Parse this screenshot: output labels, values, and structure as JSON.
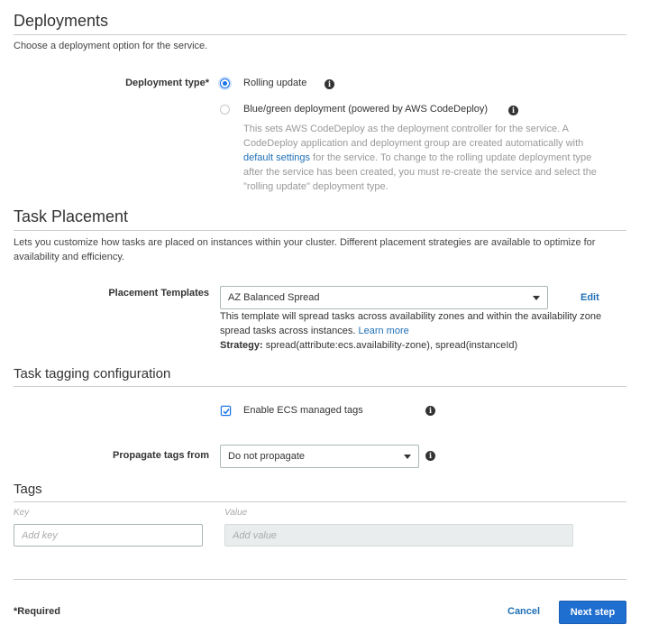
{
  "deployments": {
    "title": "Deployments",
    "description": "Choose a deployment option for the service.",
    "type_label": "Deployment type*",
    "options": [
      {
        "label": "Rolling update",
        "selected": true
      },
      {
        "label": "Blue/green deployment (powered by AWS CodeDeploy)",
        "selected": false
      }
    ],
    "bluegreen_help_1": "This sets AWS CodeDeploy as the deployment controller for the service. A CodeDeploy application and deployment group are created automatically with ",
    "bluegreen_help_link": "default settings",
    "bluegreen_help_2": " for the service. To change to the rolling update deployment type after the service has been created, you must re-create the service and select the \"rolling update\" deployment type."
  },
  "task_placement": {
    "title": "Task Placement",
    "description": "Lets you customize how tasks are placed on instances within your cluster. Different placement strategies are available to optimize for availability and efficiency.",
    "templates_label": "Placement Templates",
    "selected_template": "AZ Balanced Spread",
    "edit_label": "Edit",
    "template_help": "This template will spread tasks across availability zones and within the availability zone spread tasks across instances. ",
    "learn_more": "Learn more",
    "strategy_label": "Strategy:",
    "strategy_value": " spread(attribute:ecs.availability-zone), spread(instanceId)"
  },
  "tagging": {
    "title": "Task tagging configuration",
    "enable_label": "Enable ECS managed tags",
    "enable_checked": true,
    "propagate_label": "Propagate tags from",
    "propagate_value": "Do not propagate"
  },
  "tags": {
    "title": "Tags",
    "key_header": "Key",
    "value_header": "Value",
    "key_placeholder": "Add key",
    "value_placeholder": "Add value"
  },
  "footer": {
    "required_note": "*Required",
    "cancel_label": "Cancel",
    "next_label": "Next step"
  },
  "colors": {
    "primary_button": "#1f6fd0",
    "link": "#1f6fb5",
    "radio_accent": "#1a73e8"
  },
  "icons": [
    "info-icon",
    "chevron-down-icon",
    "check-icon"
  ]
}
